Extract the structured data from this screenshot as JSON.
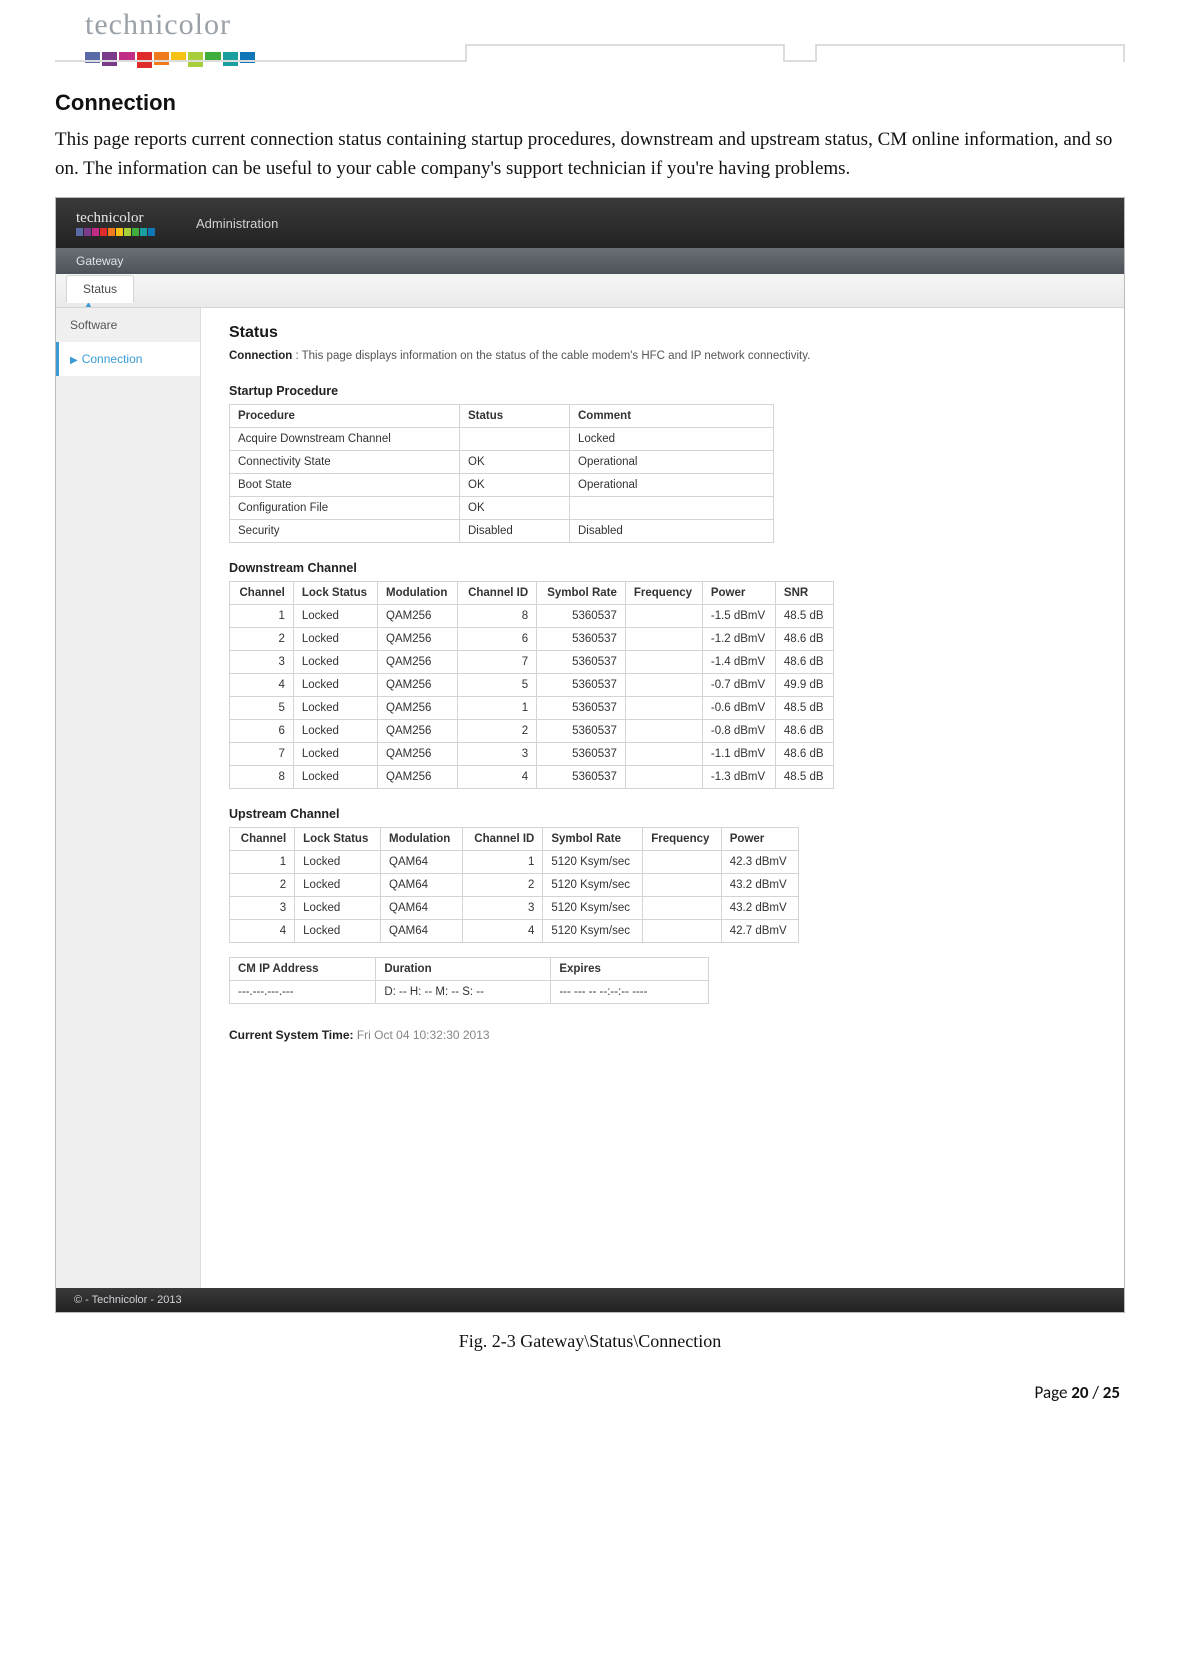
{
  "doc": {
    "brand": "technicolor",
    "rainbow_colors": [
      "#5a6aa9",
      "#7a3b8a",
      "#c12c86",
      "#e02b2b",
      "#f07b1e",
      "#f5c215",
      "#a8cf3b",
      "#3fae3d",
      "#1a9e9e",
      "#0f77b7"
    ],
    "section_title": "Connection",
    "intro": "This page reports current connection status containing startup procedures, downstream and upstream status, CM online information, and so on. The information can be useful to your cable company's support technician if you're having problems.",
    "caption": "Fig. 2-3 Gateway\\Status\\Connection",
    "page_label": "Page",
    "page_current": "20",
    "page_sep": " / ",
    "page_total": "25"
  },
  "ui": {
    "brand": "technicolor",
    "nav_admin": "Administration",
    "subnav1": "Gateway",
    "subnav2_tab": "Status",
    "sidebar": {
      "items": [
        {
          "label": "Software",
          "active": false
        },
        {
          "label": "Connection",
          "active": true
        }
      ]
    },
    "content": {
      "heading": "Status",
      "desc_label": "Connection",
      "desc_sep": "  :  ",
      "desc_text": "This page displays information on the status of the cable modem's HFC and IP network connectivity.",
      "startup": {
        "title": "Startup Procedure",
        "headers": [
          "Procedure",
          "Status",
          "Comment"
        ],
        "rows": [
          [
            "Acquire Downstream Channel",
            "",
            "Locked"
          ],
          [
            "Connectivity State",
            "OK",
            "Operational"
          ],
          [
            "Boot State",
            "OK",
            "Operational"
          ],
          [
            "Configuration File",
            "OK",
            ""
          ],
          [
            "Security",
            "Disabled",
            "Disabled"
          ]
        ]
      },
      "downstream": {
        "title": "Downstream Channel",
        "headers": [
          "Channel",
          "Lock Status",
          "Modulation",
          "Channel ID",
          "Symbol Rate",
          "Frequency",
          "Power",
          "SNR"
        ],
        "rows": [
          [
            "1",
            "Locked",
            "QAM256",
            "8",
            "5360537",
            "",
            "-1.5 dBmV",
            "48.5 dB"
          ],
          [
            "2",
            "Locked",
            "QAM256",
            "6",
            "5360537",
            "",
            "-1.2 dBmV",
            "48.6 dB"
          ],
          [
            "3",
            "Locked",
            "QAM256",
            "7",
            "5360537",
            "",
            "-1.4 dBmV",
            "48.6 dB"
          ],
          [
            "4",
            "Locked",
            "QAM256",
            "5",
            "5360537",
            "",
            "-0.7 dBmV",
            "49.9 dB"
          ],
          [
            "5",
            "Locked",
            "QAM256",
            "1",
            "5360537",
            "",
            "-0.6 dBmV",
            "48.5 dB"
          ],
          [
            "6",
            "Locked",
            "QAM256",
            "2",
            "5360537",
            "",
            "-0.8 dBmV",
            "48.6 dB"
          ],
          [
            "7",
            "Locked",
            "QAM256",
            "3",
            "5360537",
            "",
            "-1.1 dBmV",
            "48.6 dB"
          ],
          [
            "8",
            "Locked",
            "QAM256",
            "4",
            "5360537",
            "",
            "-1.3 dBmV",
            "48.5 dB"
          ]
        ]
      },
      "upstream": {
        "title": "Upstream Channel",
        "headers": [
          "Channel",
          "Lock Status",
          "Modulation",
          "Channel ID",
          "Symbol Rate",
          "Frequency",
          "Power"
        ],
        "rows": [
          [
            "1",
            "Locked",
            "QAM64",
            "1",
            "5120 Ksym/sec",
            "",
            "42.3 dBmV"
          ],
          [
            "2",
            "Locked",
            "QAM64",
            "2",
            "5120 Ksym/sec",
            "",
            "43.2 dBmV"
          ],
          [
            "3",
            "Locked",
            "QAM64",
            "3",
            "5120 Ksym/sec",
            "",
            "43.2 dBmV"
          ],
          [
            "4",
            "Locked",
            "QAM64",
            "4",
            "5120 Ksym/sec",
            "",
            "42.7 dBmV"
          ]
        ]
      },
      "cmip": {
        "headers": [
          "CM IP Address",
          "Duration",
          "Expires"
        ],
        "rows": [
          [
            "---.---.---.---",
            "D: -- H: -- M: -- S: --",
            "--- --- -- --:--:-- ----"
          ]
        ]
      },
      "systime_label": "Current System Time:",
      "systime_value": "Fri Oct 04 10:32:30 2013"
    },
    "footer": "© - Technicolor - 2013"
  }
}
